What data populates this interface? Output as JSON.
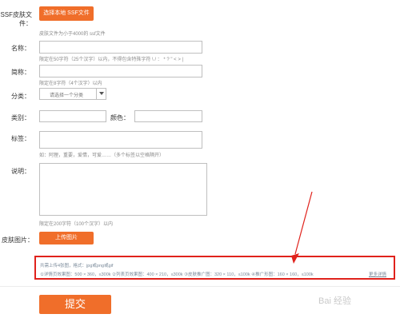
{
  "skin_file": {
    "label": "SSF皮肤文件：",
    "button": "选择本地 SSF文件",
    "hint": "皮肤文件为小于4000的 ssf文件"
  },
  "name": {
    "label": "名称：",
    "hint": "限定在50字符（25个汉字）以内，不得包含特殊字符 \\ / ： * ? \" < > |"
  },
  "short_name": {
    "label": "简称：",
    "hint": "限定在8字符（4个汉字）以内"
  },
  "category": {
    "label": "分类：",
    "placeholder": "请选择一个分类"
  },
  "type": {
    "label": "类别："
  },
  "color": {
    "label": "颜色："
  },
  "tags": {
    "label": "标签：",
    "hint": "如：阿狸，重要，爱情，可爱……（多个标签以空格隔开）"
  },
  "description": {
    "label": "说明：",
    "hint": "限定在200字符（100个汉字）以内"
  },
  "skin_image": {
    "label": "皮肤图片：",
    "button": "上传图片"
  },
  "notice": {
    "line1": "共需上传4张图，格式：jpg或png或gif",
    "line2": "①详情页效果图：500 × 360，≤300k  ②列表页效果图：400 × 210，≤300k  ③皮肤推广图：320 × 110，≤100k  ④推广形图：160 × 160，≤100k",
    "link": "更多详情"
  },
  "submit": {
    "label": "提交"
  },
  "watermark": "Bai 经验",
  "colors": {
    "accent": "#f06e2a",
    "notice_border": "#e0221c",
    "arrow": "#e0221c",
    "link": "#1f66c4"
  }
}
